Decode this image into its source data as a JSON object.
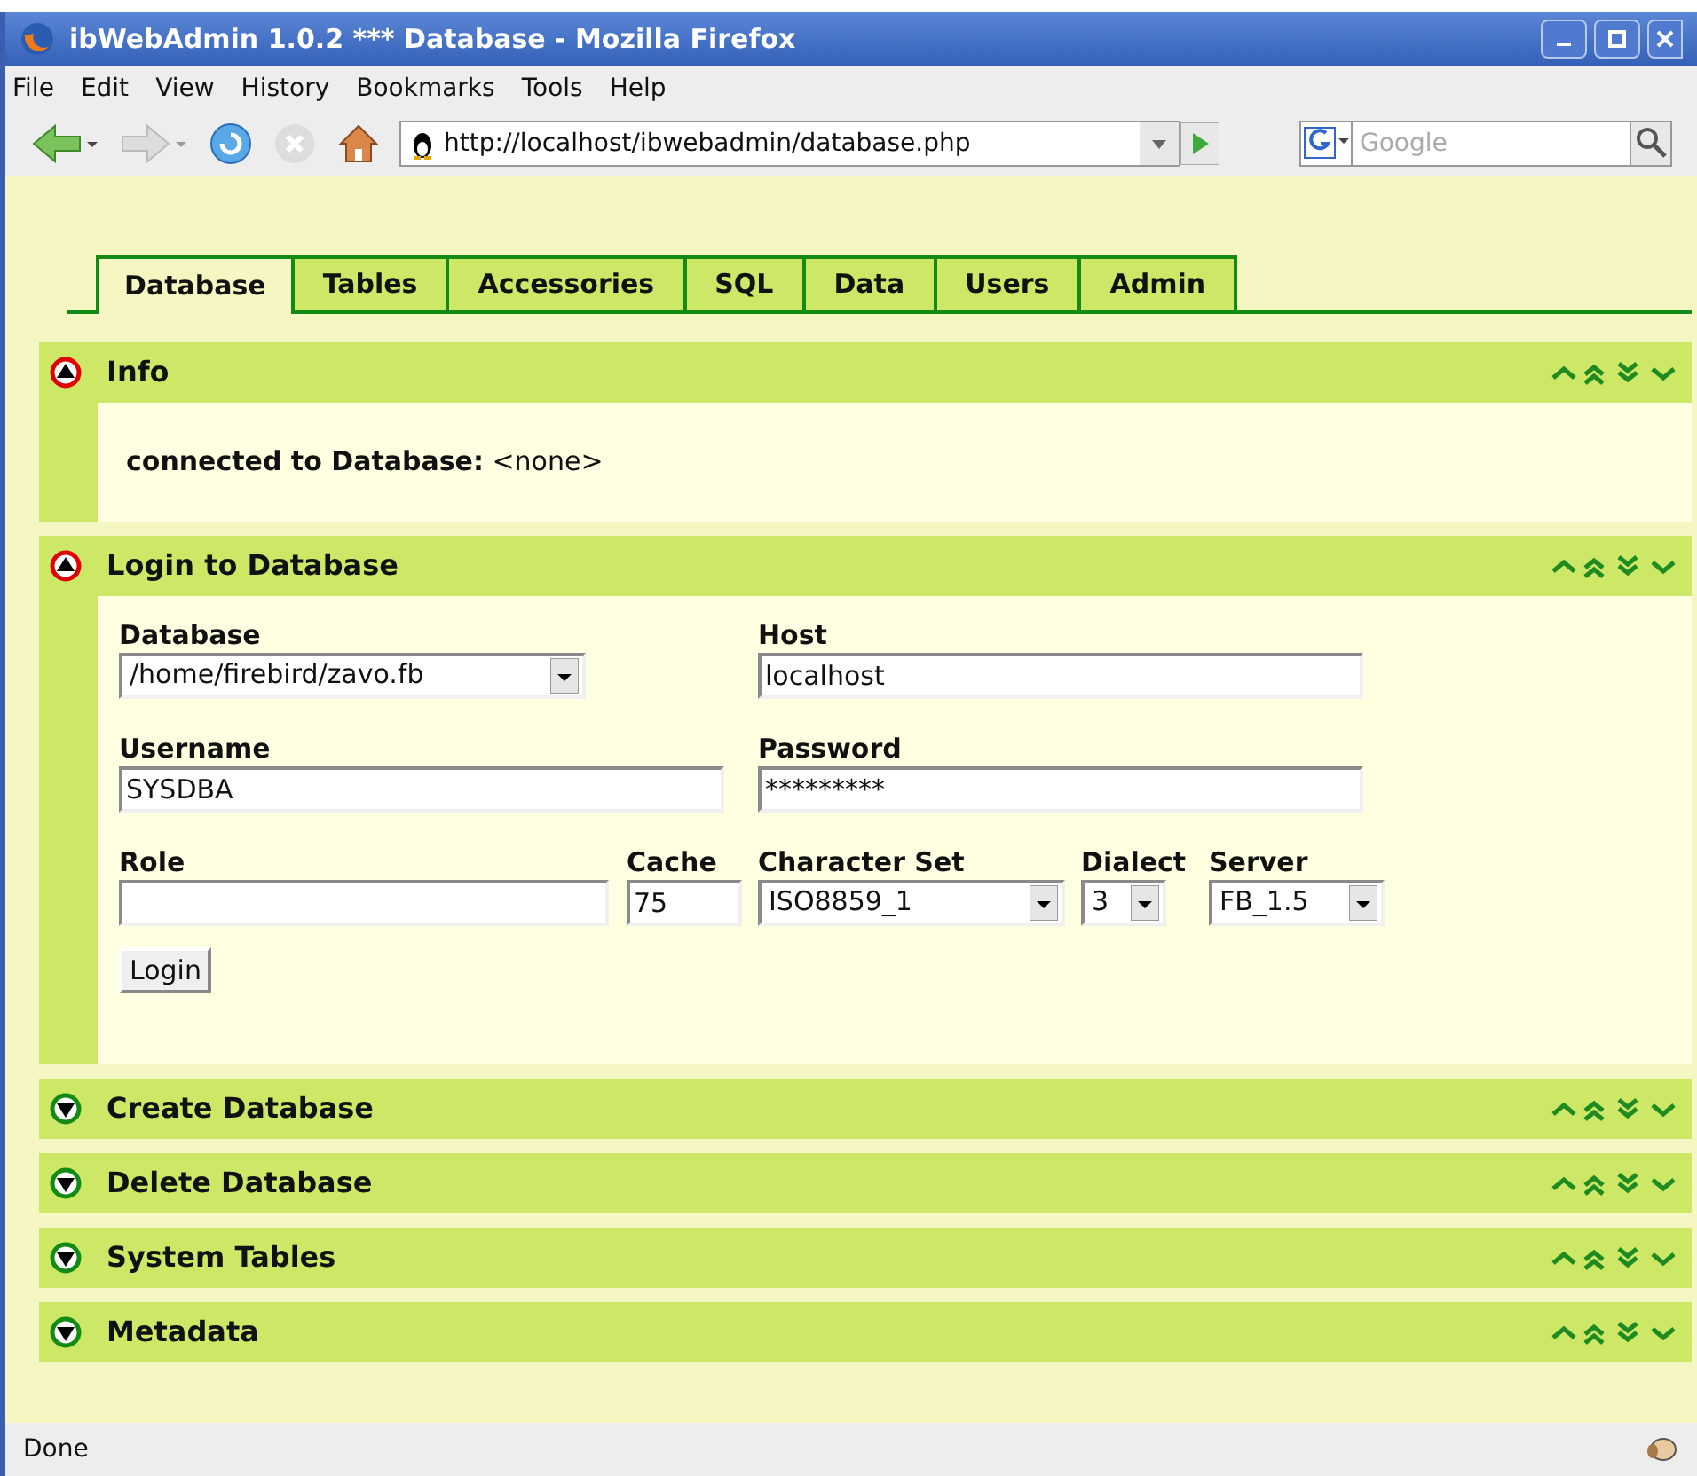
{
  "window": {
    "title": "ibWebAdmin 1.0.2 *** Database - Mozilla Firefox"
  },
  "menu": [
    "File",
    "Edit",
    "View",
    "History",
    "Bookmarks",
    "Tools",
    "Help"
  ],
  "address": {
    "value": "http://localhost/ibwebadmin/database.php"
  },
  "search": {
    "placeholder": "Google"
  },
  "tabs": [
    {
      "label": "Database",
      "selected": true
    },
    {
      "label": "Tables",
      "selected": false
    },
    {
      "label": "Accessories",
      "selected": false
    },
    {
      "label": "SQL",
      "selected": false
    },
    {
      "label": "Data",
      "selected": false
    },
    {
      "label": "Users",
      "selected": false
    },
    {
      "label": "Admin",
      "selected": false
    }
  ],
  "panels": [
    {
      "title": "Info",
      "expanded": true,
      "kind": "info",
      "label": "connected to Database:",
      "value": "<none>"
    },
    {
      "title": "Login to Database",
      "expanded": true,
      "kind": "login"
    },
    {
      "title": "Create Database",
      "expanded": false
    },
    {
      "title": "Delete Database",
      "expanded": false
    },
    {
      "title": "System Tables",
      "expanded": false
    },
    {
      "title": "Metadata",
      "expanded": false
    }
  ],
  "login": {
    "database": {
      "label": "Database",
      "value": "/home/firebird/zavo.fb"
    },
    "host": {
      "label": "Host",
      "value": "localhost"
    },
    "username": {
      "label": "Username",
      "value": "SYSDBA"
    },
    "password": {
      "label": "Password",
      "value": "*********"
    },
    "role": {
      "label": "Role"
    },
    "cache": {
      "label": "Cache",
      "value": "75"
    },
    "charset": {
      "label": "Character Set",
      "value": "ISO8859_1"
    },
    "dialect": {
      "label": "Dialect",
      "value": "3"
    },
    "server": {
      "label": "Server",
      "value": "FB_1.5"
    },
    "button": "Login"
  },
  "status_bar": {
    "text": "Done"
  }
}
